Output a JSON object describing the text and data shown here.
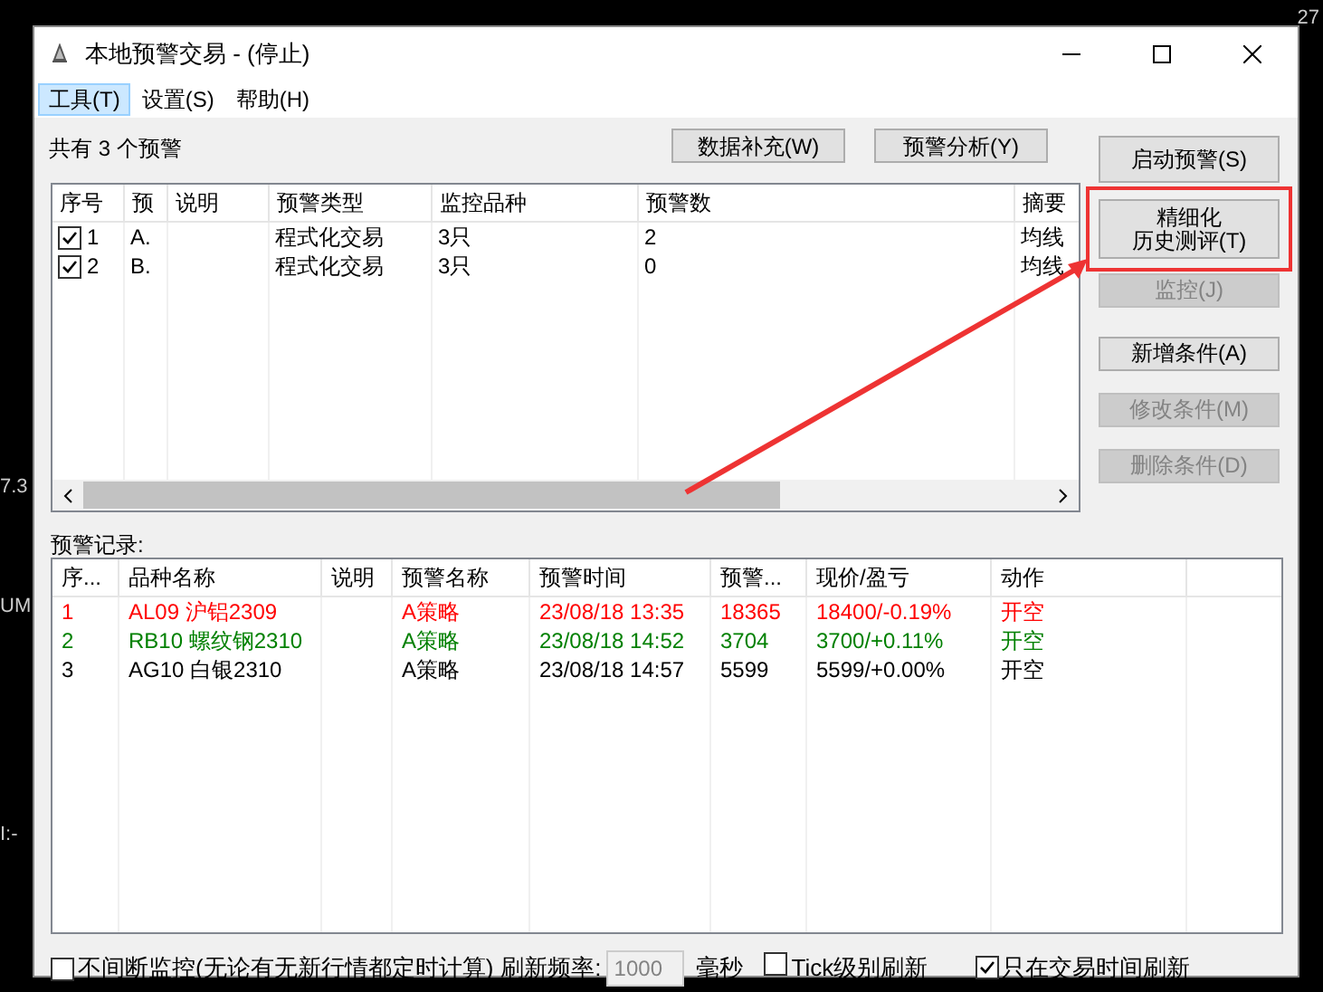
{
  "background_labels": [
    {
      "text": "27",
      "kind": "top"
    },
    {
      "text": "7.3",
      "kind": "a"
    },
    {
      "text": "UM",
      "kind": "b"
    },
    {
      "text": "I:-",
      "kind": "c"
    }
  ],
  "window": {
    "title": "本地预警交易 - (停止)"
  },
  "menu": [
    {
      "label": "工具(T)",
      "selected": true
    },
    {
      "label": "设置(S)",
      "selected": false
    },
    {
      "label": "帮助(H)",
      "selected": false
    }
  ],
  "summary": "共有 3 个预警",
  "top_buttons": [
    "数据补充(W)",
    "预警分析(Y)"
  ],
  "alerts_table": {
    "columns": [
      "序号",
      "预",
      "说明",
      "预警类型",
      "监控品种",
      "预警数",
      "摘要"
    ],
    "rows": [
      {
        "checked": true,
        "cells": [
          "1",
          "A.",
          "",
          "程式化交易",
          "3只",
          "2",
          "均线"
        ]
      },
      {
        "checked": true,
        "cells": [
          "2",
          "B.",
          "",
          "程式化交易",
          "3只",
          "0",
          "均线"
        ]
      }
    ]
  },
  "side_buttons": [
    {
      "label": "启动预警(S)",
      "disabled": false,
      "highlighted": false
    },
    {
      "lines": [
        "精细化",
        "历史测评(T)"
      ],
      "disabled": false,
      "highlighted": true
    },
    {
      "label": "监控(J)",
      "disabled": true,
      "highlighted": false
    },
    {
      "label": "新增条件(A)",
      "disabled": false,
      "highlighted": false
    },
    {
      "label": "修改条件(M)",
      "disabled": true,
      "highlighted": false
    },
    {
      "label": "删除条件(D)",
      "disabled": true,
      "highlighted": false
    }
  ],
  "records_label": "预警记录:",
  "records_table": {
    "columns": [
      "序...",
      "品种名称",
      "说明",
      "预警名称",
      "预警时间",
      "预警...",
      "现价/盈亏",
      "动作"
    ],
    "rows": [
      {
        "color": "#ff0000",
        "cells": [
          "1",
          "AL09 沪铝2309",
          "",
          "A策略",
          "23/08/18 13:35",
          "18365",
          "18400/-0.19%",
          "开空"
        ]
      },
      {
        "color": "#008000",
        "cells": [
          "2",
          "RB10 螺纹钢2310",
          "",
          "A策略",
          "23/08/18 14:52",
          "3704",
          "3700/+0.11%",
          "开空"
        ]
      },
      {
        "color": "#000000",
        "cells": [
          "3",
          "AG10 白银2310",
          "",
          "A策略",
          "23/08/18 14:57",
          "5599",
          "5599/+0.00%",
          "开空"
        ]
      }
    ]
  },
  "footer": {
    "continuous": {
      "label": "不间断监控(无论有无新行情都定时计算)",
      "checked": false
    },
    "rate_label": "刷新频率:",
    "rate_value": "1000",
    "rate_unit": "毫秒",
    "tick": {
      "label": "Tick级别刷新",
      "checked": false
    },
    "trading_only": {
      "label": "只在交易时间刷新",
      "checked": true
    }
  }
}
